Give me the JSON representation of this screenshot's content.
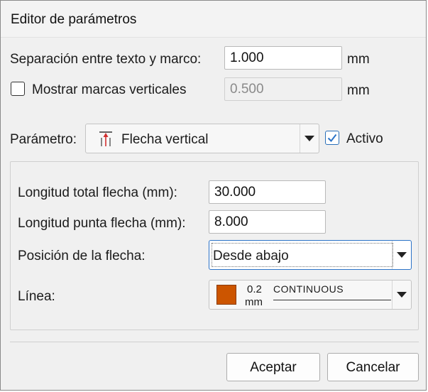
{
  "window": {
    "title": "Editor de parámetros"
  },
  "separation": {
    "label": "Separación entre texto y marco:",
    "value": "1.000",
    "unit": "mm"
  },
  "vertical_marks": {
    "label": "Mostrar marcas verticales",
    "checked": false,
    "value": "0.500",
    "unit": "mm"
  },
  "parameter": {
    "label": "Parámetro:",
    "selected": "Flecha vertical",
    "icon": "vertical-arrow-icon"
  },
  "active": {
    "label": "Activo",
    "checked": true
  },
  "group": {
    "total_length": {
      "label": "Longitud total flecha (mm):",
      "value": "30.000"
    },
    "tip_length": {
      "label": "Longitud punta flecha (mm):",
      "value": "8.000"
    },
    "arrow_position": {
      "label": "Posición de la flecha:",
      "selected": "Desde abajo"
    },
    "line": {
      "label": "Línea:",
      "width": "0.2",
      "width_unit": "mm",
      "style": "CONTINUOUS",
      "color": "#cc5500"
    }
  },
  "buttons": {
    "accept": "Aceptar",
    "cancel": "Cancelar"
  },
  "colors": {
    "accent": "#2b73c8",
    "arrow": "#d23030"
  }
}
